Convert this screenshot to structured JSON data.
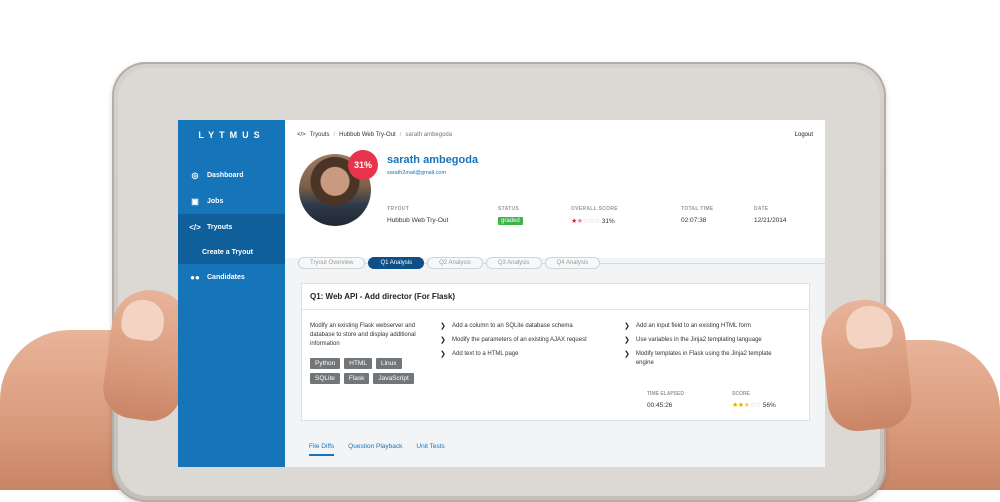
{
  "sidebar": {
    "logo": "LYTMUS",
    "items": [
      {
        "label": "Dashboard",
        "icon": "dashboard-icon"
      },
      {
        "label": "Jobs",
        "icon": "briefcase-icon"
      },
      {
        "label": "Tryouts",
        "icon": "code-icon"
      },
      {
        "label": "Create a Tryout",
        "icon": ""
      },
      {
        "label": "Candidates",
        "icon": "users-icon"
      }
    ]
  },
  "topbar": {
    "breadcrumb": [
      "Tryouts",
      "Hubbub Web Try-Out",
      "sarath ambegoda"
    ],
    "logout": "Logout"
  },
  "candidate": {
    "name": "sarath ambegoda",
    "email": "sarath2mail@gmail.com",
    "score_badge": "31%"
  },
  "meta": {
    "tryout_label": "TRYOUT",
    "tryout_value": "Hubbub Web Try-Out",
    "status_label": "STATUS",
    "status_value": "graded",
    "overall_label": "OVERALL SCORE",
    "overall_value": "31%",
    "overall_stars": 1.5,
    "time_label": "TOTAL TIME",
    "time_value": "02:07:38",
    "date_label": "DATE",
    "date_value": "12/21/2014"
  },
  "tabs": [
    "Tryout Overview",
    "Q1 Analysis",
    "Q2 Analysis",
    "Q3 Analysis",
    "Q4 Analysis"
  ],
  "question": {
    "title": "Q1: Web API - Add director (For Flask)",
    "description": "Modify an existing Flask webserver and database to store and display additional information",
    "tags": [
      "Python",
      "HTML",
      "Linux",
      "SQLite",
      "Flask",
      "JavaScript"
    ],
    "tasks_col1": [
      "Add a column to an SQLite database schema",
      "Modify the parameters of an existing AJAX request",
      "Add text to a HTML page"
    ],
    "tasks_col2": [
      "Add an input field to an existing HTML form",
      "Use variables in the Jinja2 templating language",
      "Modify templates in Flask using the Jinja2 template engine"
    ],
    "elapsed_label": "TIME ELAPSED",
    "elapsed_value": "00:45:26",
    "score_label": "SCORE",
    "score_value": "56%",
    "score_stars": 2.5
  },
  "bottom_tabs": [
    "File Diffs",
    "Question Playback",
    "Unit Tests"
  ],
  "colors": {
    "sidebar": "#1674b8",
    "accent": "#e8334c",
    "graded": "#3db34a"
  }
}
